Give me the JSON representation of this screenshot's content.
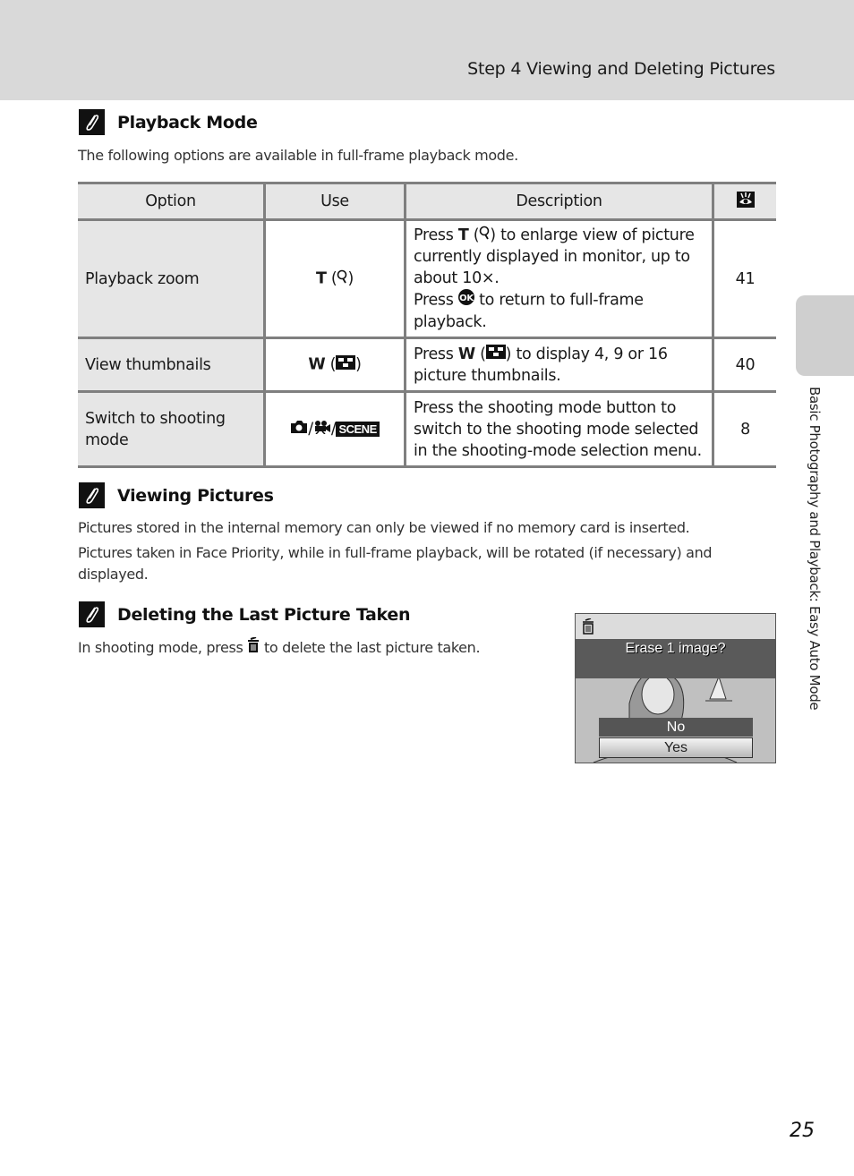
{
  "header": {
    "title": "Step 4 Viewing and Deleting Pictures"
  },
  "side_tab": {
    "label": "Basic Photography and Playback: Easy Auto Mode"
  },
  "sections": {
    "playback_mode": {
      "title": "Playback Mode",
      "intro": "The following options are available in full-frame playback mode.",
      "table": {
        "headers": {
          "option": "Option",
          "use": "Use",
          "description": "Description",
          "page_icon": "eye-reference-icon"
        },
        "rows": [
          {
            "option": "Playback zoom",
            "use_key": "T",
            "use_icon": "zoom-magnifier-icon",
            "desc": {
              "p1_pre": "Press",
              "p1_key": "T",
              "p1_post": "to enlarge view of picture currently displayed in monitor, up to about 10×.",
              "p2_pre": "Press",
              "p2_icon": "ok-button-icon",
              "p2_post": "to return to full-frame playback."
            },
            "page": "41"
          },
          {
            "option": "View thumbnails",
            "use_key": "W",
            "use_icon": "thumbnail-grid-icon",
            "desc": {
              "p1_pre": "Press",
              "p1_key": "W",
              "p1_post": "to display 4, 9 or 16 picture thumbnails."
            },
            "page": "40"
          },
          {
            "option": "Switch to shooting mode",
            "use_icons": [
              "camera-icon",
              "movie-icon",
              "scene-icon"
            ],
            "use_scene_label": "SCENE",
            "desc": {
              "p1": "Press the shooting mode button to switch to the shooting mode selected in the shooting-mode selection menu."
            },
            "page": "8"
          }
        ]
      }
    },
    "viewing_pictures": {
      "title": "Viewing Pictures",
      "p1": "Pictures stored in the internal memory can only be viewed if no memory card is inserted.",
      "p2": "Pictures taken in Face Priority, while in full-frame playback, will be rotated (if necessary) and displayed."
    },
    "deleting_last": {
      "title": "Deleting the Last Picture Taken",
      "text_pre": "In shooting mode, press",
      "text_icon": "trash-icon",
      "text_post": "to delete the last picture taken.",
      "screen": {
        "message": "Erase 1 image?",
        "options": [
          "No",
          "Yes"
        ],
        "selected": "Yes"
      }
    }
  },
  "page_number": "25"
}
